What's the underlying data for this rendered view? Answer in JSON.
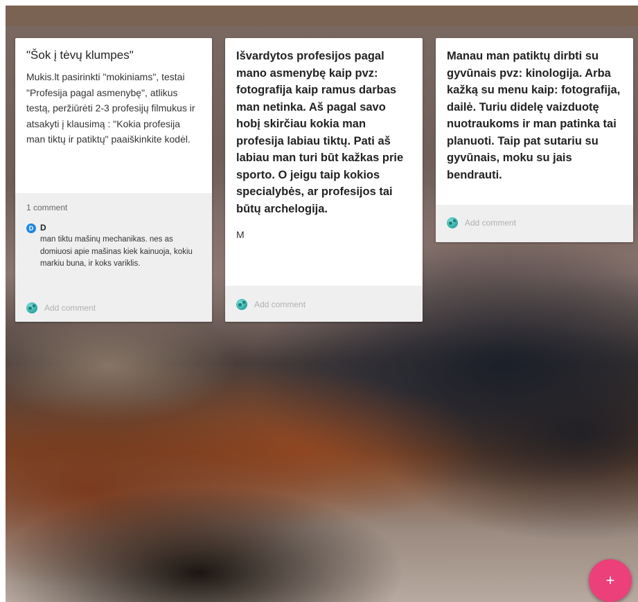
{
  "cards": [
    {
      "title": "\"Šok į tėvų klumpes\"",
      "text": "Mukis.lt pasirinkti \"mokiniams\", testai \"Profesija pagal asmenybę\", atlikus testą, peržiūrėti 2-3 profesijų filmukus ir atsakyti į klausimą : \"Kokia profesija man tiktų ir patiktų\" paaiškinkite kodėl.",
      "comment_count": "1 comment",
      "comment": {
        "avatar_initial": "D",
        "author": "D",
        "text": "man tiktu mašinų mechanikas. nes as domiuosi apie mašinas kiek kainuoja, kokiu markiu buna, ir koks variklis."
      },
      "add_comment": "Add comment"
    },
    {
      "text": "Išvardytos profesijos pagal mano asmenybę kaip pvz: fotografija kaip ramus darbas man netinka. Aš pagal savo hobį skirčiau kokia man profesija labiau tiktų. Pati aš labiau man turi būt kažkas prie sporto. O jeigu taip kokios specialybės, ar profesijos tai būtų archelogija.",
      "signature": "M",
      "add_comment": "Add comment"
    },
    {
      "text": "Manau man patiktų dirbti su gyvūnais pvz: kinologija. Arba kažką su menu kaip: fotografija, dailė. Turiu didelę vaizduotę nuotraukoms ir man patinka tai planuoti. Taip pat sutariu su gyvūnais, moku su jais bendrauti.",
      "add_comment": "Add comment"
    }
  ],
  "fab": {
    "label": "+"
  },
  "colors": {
    "topbar": "#7a6352",
    "fab": "#ec407a",
    "avatar": "#1e88e5"
  }
}
